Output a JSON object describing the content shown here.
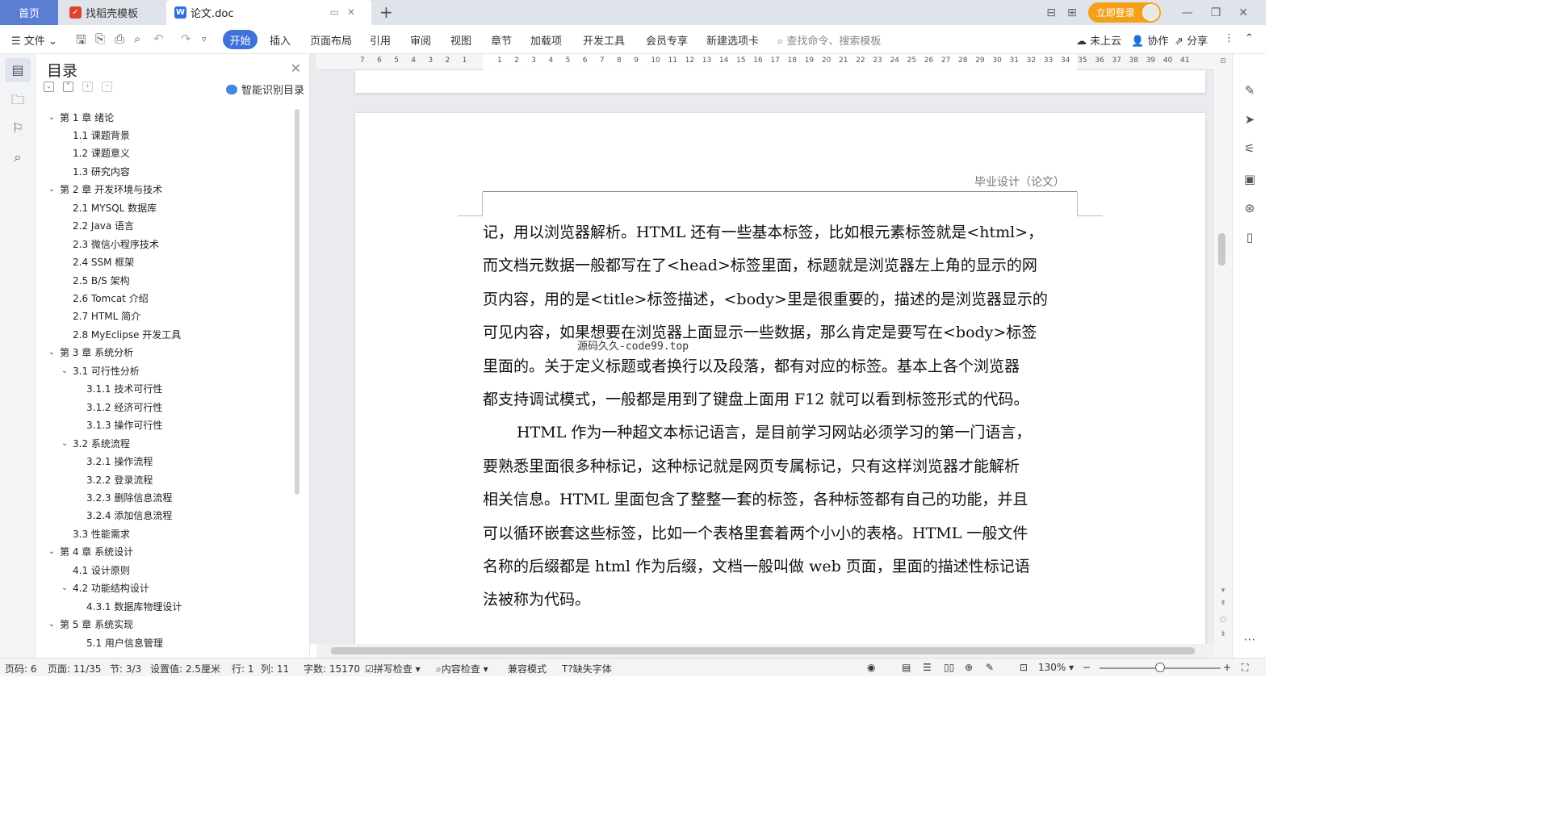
{
  "titlebar": {
    "tabs": [
      {
        "label": "首页"
      },
      {
        "label": "找稻壳模板"
      },
      {
        "label": "论文.doc"
      }
    ],
    "login_label": "立即登录"
  },
  "ribbon": {
    "file_menu": "文件",
    "tabs": [
      "开始",
      "插入",
      "页面布局",
      "引用",
      "审阅",
      "视图",
      "章节",
      "加载项",
      "开发工具",
      "会员专享",
      "新建选项卡"
    ],
    "search_placeholder": "查找命令、搜索模板",
    "cloud_label": "未上云",
    "collab_label": "协作",
    "share_label": "分享"
  },
  "toc": {
    "title": "目录",
    "smart_label": "智能识别目录",
    "items": [
      {
        "label": "第 1 章  绪论",
        "level": 1,
        "expanded": true
      },
      {
        "label": "1.1  课题背景",
        "level": 2
      },
      {
        "label": "1.2  课题意义",
        "level": 2
      },
      {
        "label": "1.3  研究内容",
        "level": 2
      },
      {
        "label": "第 2 章  开发环境与技术",
        "level": 1,
        "expanded": true
      },
      {
        "label": "2.1  MYSQL 数据库",
        "level": 2
      },
      {
        "label": "2.2 Java 语言",
        "level": 2
      },
      {
        "label": "2.3  微信小程序技术",
        "level": 2
      },
      {
        "label": "2.4 SSM 框架",
        "level": 2
      },
      {
        "label": "2.5 B/S 架构",
        "level": 2
      },
      {
        "label": "2.6 Tomcat 介绍",
        "level": 2
      },
      {
        "label": "2.7 HTML 简介",
        "level": 2
      },
      {
        "label": "2.8 MyEclipse 开发工具",
        "level": 2
      },
      {
        "label": "第 3 章  系统分析",
        "level": 1,
        "expanded": true
      },
      {
        "label": "3.1  可行性分析",
        "level": 2,
        "expanded": true
      },
      {
        "label": "3.1.1  技术可行性",
        "level": 3
      },
      {
        "label": "3.1.2  经济可行性",
        "level": 3
      },
      {
        "label": "3.1.3  操作可行性",
        "level": 3
      },
      {
        "label": "3.2  系统流程",
        "level": 2,
        "expanded": true
      },
      {
        "label": "3.2.1  操作流程",
        "level": 3
      },
      {
        "label": "3.2.2  登录流程",
        "level": 3
      },
      {
        "label": "3.2.3  删除信息流程",
        "level": 3
      },
      {
        "label": "3.2.4  添加信息流程",
        "level": 3
      },
      {
        "label": "3.3  性能需求",
        "level": 2
      },
      {
        "label": "第 4 章  系统设计",
        "level": 1,
        "expanded": true
      },
      {
        "label": "4.1  设计原则",
        "level": 2
      },
      {
        "label": "4.2  功能结构设计",
        "level": 2,
        "expanded": true
      },
      {
        "label": "4.3.1  数据库物理设计",
        "level": 3
      },
      {
        "label": "第 5 章  系统实现",
        "level": 1,
        "expanded": true
      },
      {
        "label": "5.1 用户信息管理",
        "level": 3
      }
    ]
  },
  "ruler": {
    "left_numbers": [
      "7",
      "6",
      "5",
      "4",
      "3",
      "2",
      "1"
    ],
    "right_numbers": [
      "1",
      "2",
      "3",
      "4",
      "5",
      "6",
      "7",
      "8",
      "9",
      "10",
      "11",
      "12",
      "13",
      "14",
      "15",
      "16",
      "17",
      "18",
      "19",
      "20",
      "21",
      "22",
      "23",
      "24",
      "25",
      "26",
      "27",
      "28",
      "29",
      "30",
      "31",
      "32",
      "33",
      "34",
      "35",
      "36",
      "37",
      "38",
      "39",
      "40",
      "41"
    ]
  },
  "document": {
    "header_text": "毕业设计（论文）",
    "lines": [
      "记，用以浏览器解析。HTML 还有一些基本标签，比如根元素标签就是<html>，",
      "而文档元数据一般都写在了<head>标签里面，标题就是浏览器左上角的显示的网",
      "页内容，用的是<title>标签描述，<body>里是很重要的，描述的是浏览器显示的",
      "可见内容，如果想要在浏览器上面显示一些数据，那么肯定是要写在<body>标签",
      "里面的。关于定义标题或者换行以及段落，都有对应的标签。基本上各个浏览器",
      "都支持调试模式，一般都是用到了键盘上面用 F12 就可以看到标签形式的代码。",
      "HTML 作为一种超文本标记语言，是目前学习网站必须学习的第一门语言，",
      "要熟悉里面很多种标记，这种标记就是网页专属标记，只有这样浏览器才能解析",
      "相关信息。HTML 里面包含了整整一套的标签，各种标签都有自己的功能，并且",
      "可以循环嵌套这些标签，比如一个表格里套着两个小小的表格。HTML 一般文件",
      "名称的后缀都是 html 作为后缀，文档一般叫做 web 页面，里面的描述性标记语",
      "法被称为代码。"
    ],
    "watermark": "源码久久-code99.top"
  },
  "status": {
    "page_num": "页码: 6",
    "pages": "页面: 11/35",
    "section": "节: 3/3",
    "setting": "设置值: 2.5厘米",
    "row": "行: 1",
    "col": "列: 11",
    "word_count": "字数: 15170",
    "spell_check": "拼写检查",
    "content_check": "内容检查",
    "compat_mode": "兼容模式",
    "missing_font": "缺失字体",
    "zoom": "130%"
  }
}
